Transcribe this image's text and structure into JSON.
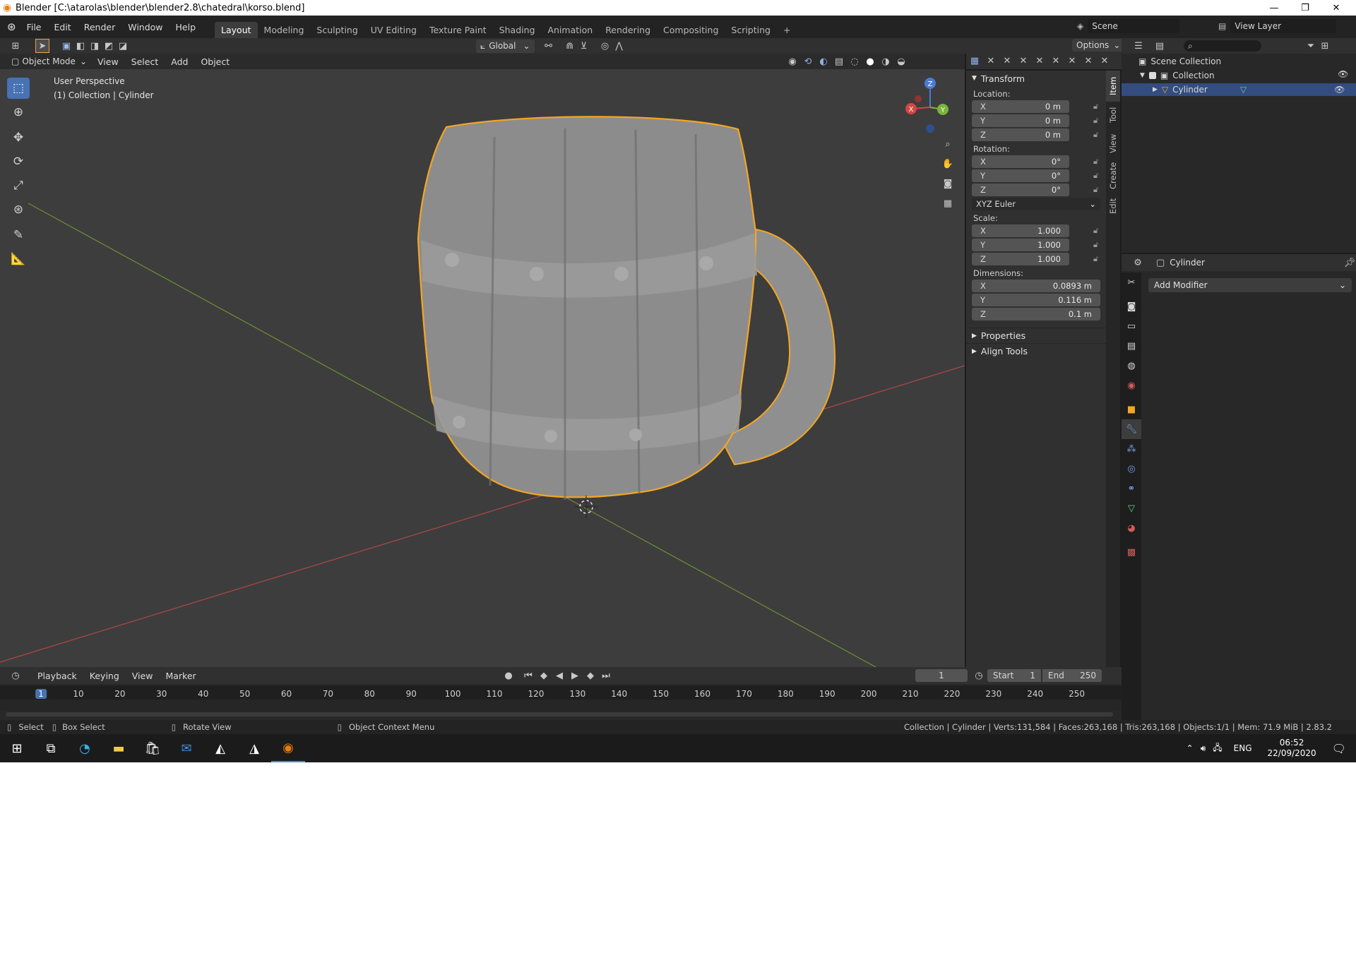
{
  "window": {
    "title": "Blender [C:\\atarolas\\blender\\blender2.8\\chatedral\\korso.blend]",
    "controls": [
      "—",
      "❐",
      "✕"
    ]
  },
  "menubar": {
    "items": [
      "File",
      "Edit",
      "Render",
      "Window",
      "Help"
    ]
  },
  "workspaces": {
    "tabs": [
      "Layout",
      "Modeling",
      "Sculpting",
      "UV Editing",
      "Texture Paint",
      "Shading",
      "Animation",
      "Rendering",
      "Compositing",
      "Scripting"
    ],
    "add": "+"
  },
  "scene": {
    "label": "Scene",
    "view_layer": "View Layer"
  },
  "tool_header": {
    "orientation": "Global",
    "options": "Options"
  },
  "viewport_header": {
    "mode": "Object Mode",
    "menus": [
      "View",
      "Select",
      "Add",
      "Object"
    ]
  },
  "viewport": {
    "perspective": "User Perspective",
    "context": "(1) Collection | Cylinder",
    "gizmo": {
      "x": "X",
      "y": "Y",
      "z": "Z"
    }
  },
  "npanel": {
    "transform_title": "Transform",
    "location_label": "Location:",
    "location": [
      {
        "axis": "X",
        "value": "0 m"
      },
      {
        "axis": "Y",
        "value": "0 m"
      },
      {
        "axis": "Z",
        "value": "0 m"
      }
    ],
    "rotation_label": "Rotation:",
    "rotation": [
      {
        "axis": "X",
        "value": "0°"
      },
      {
        "axis": "Y",
        "value": "0°"
      },
      {
        "axis": "Z",
        "value": "0°"
      }
    ],
    "rotation_mode": "XYZ Euler",
    "scale_label": "Scale:",
    "scale": [
      {
        "axis": "X",
        "value": "1.000"
      },
      {
        "axis": "Y",
        "value": "1.000"
      },
      {
        "axis": "Z",
        "value": "1.000"
      }
    ],
    "dimensions_label": "Dimensions:",
    "dimensions": [
      {
        "axis": "X",
        "value": "0.0893 m"
      },
      {
        "axis": "Y",
        "value": "0.116 m"
      },
      {
        "axis": "Z",
        "value": "0.1 m"
      }
    ],
    "properties_title": "Properties",
    "align_tools_title": "Align Tools",
    "tabs": [
      "Item",
      "Tool",
      "View",
      "Create",
      "Edit"
    ]
  },
  "outliner": {
    "scene_collection": "Scene Collection",
    "collection": "Collection",
    "object": "Cylinder"
  },
  "properties": {
    "object_name": "Cylinder",
    "add_modifier": "Add Modifier"
  },
  "timeline": {
    "menus": [
      "Playback",
      "Keying",
      "View",
      "Marker"
    ],
    "current_frame": "1",
    "start_label": "Start",
    "start": "1",
    "end_label": "End",
    "end": "250",
    "ticks": [
      "1",
      "10",
      "20",
      "30",
      "40",
      "50",
      "60",
      "70",
      "80",
      "90",
      "100",
      "110",
      "120",
      "130",
      "140",
      "150",
      "160",
      "170",
      "180",
      "190",
      "200",
      "210",
      "220",
      "230",
      "240",
      "250"
    ]
  },
  "statusbar": {
    "select": "Select",
    "box_select": "Box Select",
    "rotate_view": "Rotate View",
    "context_menu": "Object Context Menu",
    "stats": "Collection | Cylinder | Verts:131,584 | Faces:263,168 | Tris:263,168 | Objects:1/1 | Mem: 71.9 MiB | 2.83.2"
  },
  "taskbar": {
    "lang": "ENG",
    "time": "06:52",
    "date": "22/09/2020"
  },
  "colors": {
    "accent": "#4772b3",
    "selection_outline": "#f5a623",
    "viewport_bg": "#3d3d3d",
    "axis_x": "#c94848",
    "axis_y": "#7aa03a"
  }
}
